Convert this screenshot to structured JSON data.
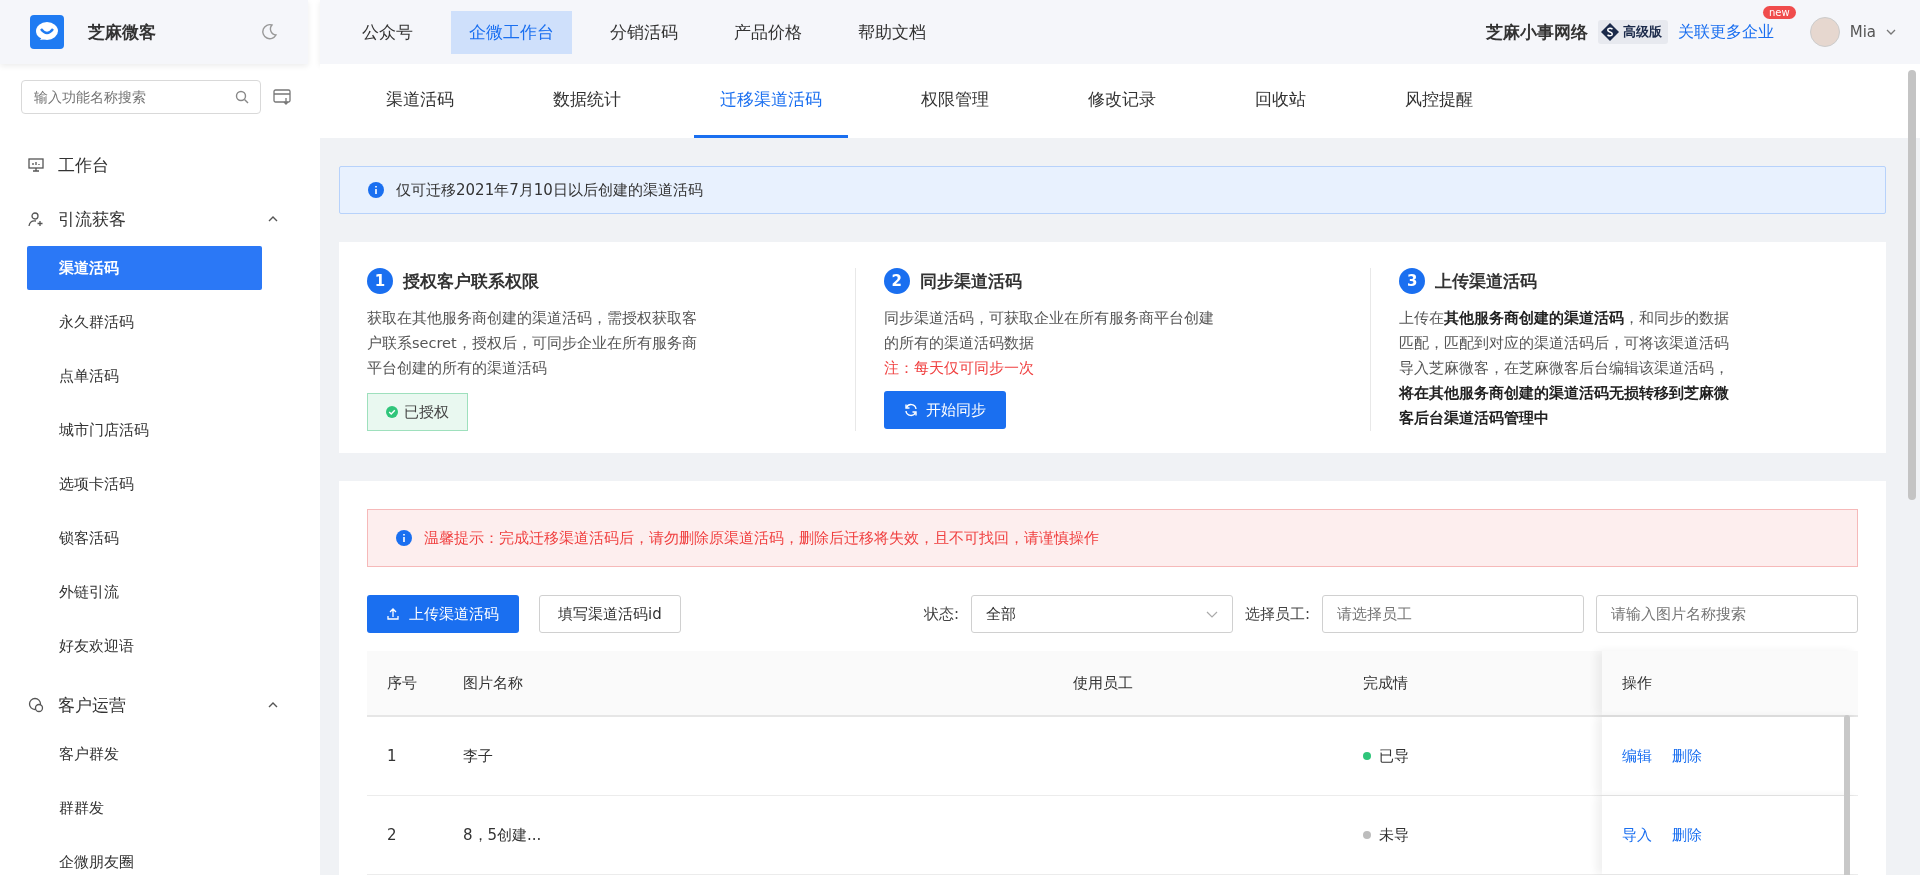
{
  "sidebar": {
    "brand": "芝麻微客",
    "search": {
      "placeholder": "输入功能名称搜索"
    },
    "groups": [
      {
        "label": "工作台",
        "kind": "link"
      },
      {
        "label": "引流获客",
        "kind": "group",
        "expanded": true,
        "children": [
          {
            "label": "渠道活码",
            "selected": true
          },
          {
            "label": "永久群活码",
            "selected": false
          },
          {
            "label": "点单活码",
            "selected": false
          },
          {
            "label": "城市门店活码",
            "selected": false
          },
          {
            "label": "选项卡活码",
            "selected": false
          },
          {
            "label": "锁客活码",
            "selected": false
          },
          {
            "label": "外链引流",
            "selected": false
          },
          {
            "label": "好友欢迎语",
            "selected": false
          }
        ]
      },
      {
        "label": "客户运营",
        "kind": "group",
        "expanded": true,
        "children": [
          {
            "label": "客户群发",
            "selected": false
          },
          {
            "label": "群群发",
            "selected": false
          },
          {
            "label": "企微朋友圈",
            "selected": false
          }
        ]
      }
    ]
  },
  "top_nav": [
    {
      "label": "公众号",
      "selected": false
    },
    {
      "label": "企微工作台",
      "selected": true
    },
    {
      "label": "分销活码",
      "selected": false
    },
    {
      "label": "产品价格",
      "selected": false
    },
    {
      "label": "帮助文档",
      "selected": false
    }
  ],
  "account": {
    "company": "芝麻小事网络",
    "plan": "高级版",
    "link": "关联更多企业",
    "badge": "new",
    "user": "Mia"
  },
  "tabs": [
    {
      "label": "渠道活码",
      "selected": false
    },
    {
      "label": "数据统计",
      "selected": false
    },
    {
      "label": "迁移渠道活码",
      "selected": true
    },
    {
      "label": "权限管理",
      "selected": false
    },
    {
      "label": "修改记录",
      "selected": false
    },
    {
      "label": "回收站",
      "selected": false
    },
    {
      "label": "风控提醒",
      "selected": false
    }
  ],
  "notice": "仅可迁移2021年7月10日以后创建的渠道活码",
  "steps": [
    {
      "number": "1",
      "title": "授权客户联系权限",
      "text": "获取在其他服务商创建的渠道活码，需授权获取客户联系secret，授权后，可同步企业在所有服务商平台创建的所有的渠道活码",
      "action": {
        "kind": "status",
        "label": "已授权"
      }
    },
    {
      "number": "2",
      "title": "同步渠道活码",
      "text": "同步渠道活码，可获取企业在所有服务商平台创建的所有的渠道活码数据",
      "note": "注：每天仅可同步一次",
      "action": {
        "kind": "button",
        "label": "开始同步"
      }
    },
    {
      "number": "3",
      "title": "上传渠道活码",
      "text": "上传在**其他服务商创建的渠道活码**，和同步的数据匹配，匹配到对应的渠道活码后，可将该渠道活码导入芝麻微客，在芝麻微客后台编辑该渠道活码，**将在其他服务商创建的渠道活码无损转移到芝麻微客后台渠道活码管理中**",
      "action": {
        "kind": "none"
      }
    }
  ],
  "warning": "温馨提示：完成迁移渠道活码后，请勿删除原渠道活码，删除后迁移将失效，且不可找回，请谨慎操作",
  "toolbar": {
    "upload": "上传渠道活码",
    "fill_id": "填写渠道活码id",
    "status_label": "状态:",
    "status_value": "全部",
    "staff_label": "选择员工:",
    "staff_placeholder": "请选择员工",
    "search_placeholder": "请输入图片名称搜索"
  },
  "table": {
    "columns": [
      "序号",
      "图片名称",
      "使用员工",
      "完成情",
      "操作"
    ],
    "rows": [
      {
        "index": "1",
        "name": "李子",
        "status": "已导",
        "done": true,
        "actions": [
          "编辑",
          "删除"
        ]
      },
      {
        "index": "2",
        "name": "8，5创建...",
        "status": "未导",
        "done": false,
        "actions": [
          "导入",
          "删除"
        ]
      }
    ]
  }
}
